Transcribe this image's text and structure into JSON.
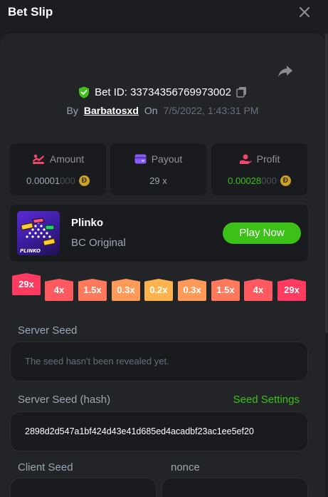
{
  "header": {
    "title": "Bet Slip"
  },
  "bet": {
    "id_label": "Bet ID:",
    "id": "33734356769973002",
    "by_label": "By",
    "user": "Barbatosxd",
    "on_label": "On",
    "date": "7/5/2022, 1:43:31 PM"
  },
  "stats": {
    "amount": {
      "label": "Amount",
      "value_main": "0.00001",
      "value_dim": "000"
    },
    "payout": {
      "label": "Payout",
      "value": "29 x"
    },
    "profit": {
      "label": "Profit",
      "value_main": "0.00028",
      "value_dim": "000"
    }
  },
  "coin_symbol": "Đ",
  "game": {
    "thumb_text": "PLINKO",
    "name": "Plinko",
    "provider": "BC Original",
    "play_label": "Play Now"
  },
  "multipliers": [
    "29x",
    "4x",
    "1.5x",
    "0.3x",
    "0.2x",
    "0.3x",
    "1.5x",
    "4x",
    "29x"
  ],
  "multiplier_colors": [
    "#ff3c5f",
    "#ff5a5f",
    "#ff7a5c",
    "#ff9a58",
    "#ffb24e",
    "#ff9a58",
    "#ff7a5c",
    "#ff5a5f",
    "#ff3c5f"
  ],
  "multiplier_active_index": 0,
  "server_seed": {
    "label": "Server Seed",
    "value": "The seed hasn't been revealed yet."
  },
  "server_seed_hash": {
    "label": "Server Seed (hash)",
    "settings_label": "Seed Settings",
    "value": "2898d2d547a1bf424d43e41d685ed4acadbf23ac1ee5ef20"
  },
  "client_seed": {
    "label": "Client Seed",
    "value": ""
  },
  "nonce": {
    "label": "nonce",
    "value": ""
  },
  "colors": {
    "accent_green": "#3bc117",
    "bg": "#1c1d20",
    "panel": "#232427",
    "card": "#1a1b1e"
  }
}
